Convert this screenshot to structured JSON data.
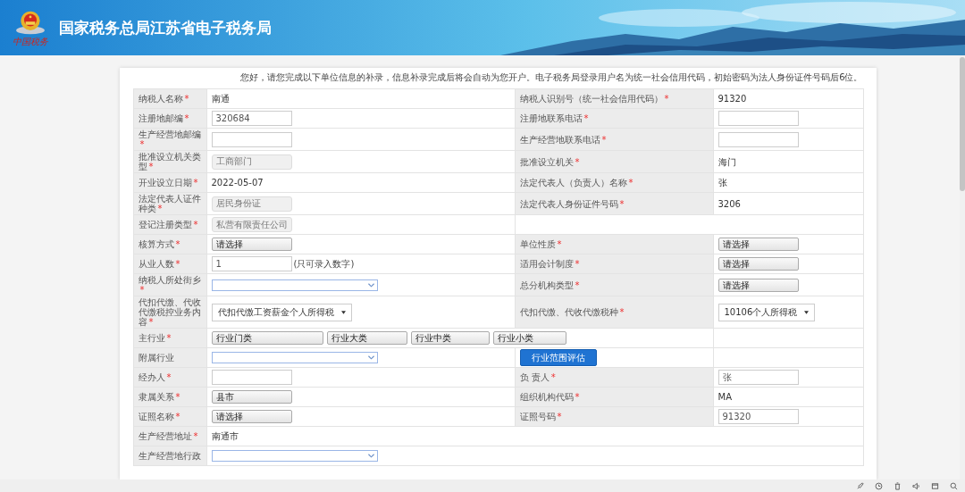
{
  "header": {
    "title": "国家税务总局江苏省电子税务局",
    "logo_text": "中国税务"
  },
  "notice": "您好，请您完成以下单位信息的补录，信息补录完成后将会自动为您开户。电子税务局登录用户名为统一社会信用代码，初始密码为法人身份证件号码后6位。",
  "rows": [
    {
      "kind": "pair",
      "cells": [
        {
          "kind": "label",
          "text": "纳税人名称",
          "star": "*"
        },
        {
          "kind": "text",
          "value": "南通"
        },
        {
          "kind": "label",
          "text": "纳税人识别号（统一社会信用代码）",
          "star": "*"
        },
        {
          "kind": "text",
          "value": "91320"
        }
      ]
    },
    {
      "kind": "pair",
      "cells": [
        {
          "kind": "label",
          "text": "注册地邮编",
          "star": "*"
        },
        {
          "kind": "input",
          "value": "320684",
          "disabled": false
        },
        {
          "kind": "label",
          "text": "注册地联系电话",
          "star": "*"
        },
        {
          "kind": "input",
          "disabled": false
        }
      ]
    },
    {
      "kind": "pair",
      "cells": [
        {
          "kind": "label",
          "text": "生产经营地邮编",
          "star": "*"
        },
        {
          "kind": "input",
          "disabled": false
        },
        {
          "kind": "label",
          "text": "生产经营地联系电话",
          "star": "*"
        },
        {
          "kind": "input",
          "disabled": false
        }
      ]
    },
    {
      "kind": "pair",
      "cells": [
        {
          "kind": "label",
          "text": "批准设立机关类型",
          "star": "*"
        },
        {
          "kind": "input",
          "value": "工商部门",
          "disabled": true
        },
        {
          "kind": "label",
          "text": "批准设立机关",
          "star": "*"
        },
        {
          "kind": "text",
          "value": "海门"
        }
      ]
    },
    {
      "kind": "pair",
      "cells": [
        {
          "kind": "label",
          "text": "开业设立日期",
          "star": "*"
        },
        {
          "kind": "text",
          "value": "2022-05-07"
        },
        {
          "kind": "label",
          "text": "法定代表人（负责人）名称",
          "star": "*"
        },
        {
          "kind": "text",
          "value": "张"
        }
      ]
    },
    {
      "kind": "pair",
      "cells": [
        {
          "kind": "label",
          "text": "法定代表人证件种类",
          "star": "*"
        },
        {
          "kind": "input",
          "value": "居民身份证",
          "disabled": true
        },
        {
          "kind": "label",
          "text": "法定代表人身份证件号码",
          "star": "*"
        },
        {
          "kind": "text",
          "value": "3206"
        }
      ]
    },
    {
      "kind": "half",
      "cells": [
        {
          "kind": "label",
          "text": "登记注册类型",
          "star": "*"
        },
        {
          "kind": "input",
          "value": "私营有限责任公司",
          "disabled": true
        },
        {
          "kind": "empty"
        }
      ]
    },
    {
      "kind": "pair",
      "cells": [
        {
          "kind": "label",
          "text": "核算方式",
          "star": "*"
        },
        {
          "kind": "picker",
          "value": "请选择"
        },
        {
          "kind": "label",
          "text": "单位性质",
          "star": "*"
        },
        {
          "kind": "picker",
          "value": "请选择"
        }
      ]
    },
    {
      "kind": "pair",
      "cells": [
        {
          "kind": "label",
          "text": "从业人数",
          "star": "*"
        },
        {
          "kind": "input",
          "value": "1",
          "disabled": false,
          "hint": "(只可录入数字)"
        },
        {
          "kind": "label",
          "text": "适用会计制度",
          "star": "*"
        },
        {
          "kind": "picker",
          "value": "请选择"
        }
      ]
    },
    {
      "kind": "pair",
      "cells": [
        {
          "kind": "label",
          "text": "纳税人所处街乡",
          "star": "*"
        },
        {
          "kind": "combo"
        },
        {
          "kind": "label",
          "text": "总分机构类型",
          "star": "*"
        },
        {
          "kind": "picker",
          "value": "请选择"
        }
      ]
    },
    {
      "kind": "pair",
      "cells": [
        {
          "kind": "label",
          "text": "代扣代缴、代收代缴税控业务内容",
          "star": "*"
        },
        {
          "kind": "select",
          "value": "代扣代缴工资薪金个人所得税"
        },
        {
          "kind": "label",
          "text": "代扣代缴、代收代缴税种",
          "star": "*"
        },
        {
          "kind": "select",
          "value": "10106个人所得税"
        }
      ]
    },
    {
      "kind": "industry",
      "cells": [
        {
          "kind": "label",
          "text": "主行业",
          "star": "*"
        },
        {
          "kind": "buttons",
          "items": [
            "行业门类",
            "行业大类",
            "行业中类",
            "行业小类"
          ]
        },
        {
          "kind": "empty"
        }
      ]
    },
    {
      "kind": "pair",
      "cells": [
        {
          "kind": "label",
          "text": "附属行业"
        },
        {
          "kind": "combo"
        },
        {
          "kind": "button",
          "value": "行业范围评估"
        },
        {
          "kind": "empty"
        }
      ]
    },
    {
      "kind": "pair",
      "cells": [
        {
          "kind": "label",
          "text": "经办人",
          "star": "*"
        },
        {
          "kind": "input",
          "disabled": false
        },
        {
          "kind": "label",
          "text": "负 责人",
          "star": "*"
        },
        {
          "kind": "input",
          "value": "张",
          "disabled": false
        }
      ]
    },
    {
      "kind": "pair",
      "cells": [
        {
          "kind": "label",
          "text": "隶属关系",
          "star": "*"
        },
        {
          "kind": "picker",
          "value": "县市"
        },
        {
          "kind": "label",
          "text": "组织机构代码",
          "star": "*"
        },
        {
          "kind": "text",
          "value": "MA"
        }
      ]
    },
    {
      "kind": "pair",
      "cells": [
        {
          "kind": "label",
          "text": "证照名称",
          "star": "*"
        },
        {
          "kind": "picker",
          "value": "请选择"
        },
        {
          "kind": "label",
          "text": "证照号码",
          "star": "*"
        },
        {
          "kind": "input",
          "value": "91320",
          "disabled": false
        }
      ]
    },
    {
      "kind": "wide",
      "cells": [
        {
          "kind": "label",
          "text": "生产经营地址",
          "star": "*"
        },
        {
          "kind": "text",
          "value": "南通市"
        }
      ]
    },
    {
      "kind": "wide",
      "cells": [
        {
          "kind": "label",
          "text": "生产经营地行政"
        },
        {
          "kind": "combo"
        }
      ]
    }
  ]
}
